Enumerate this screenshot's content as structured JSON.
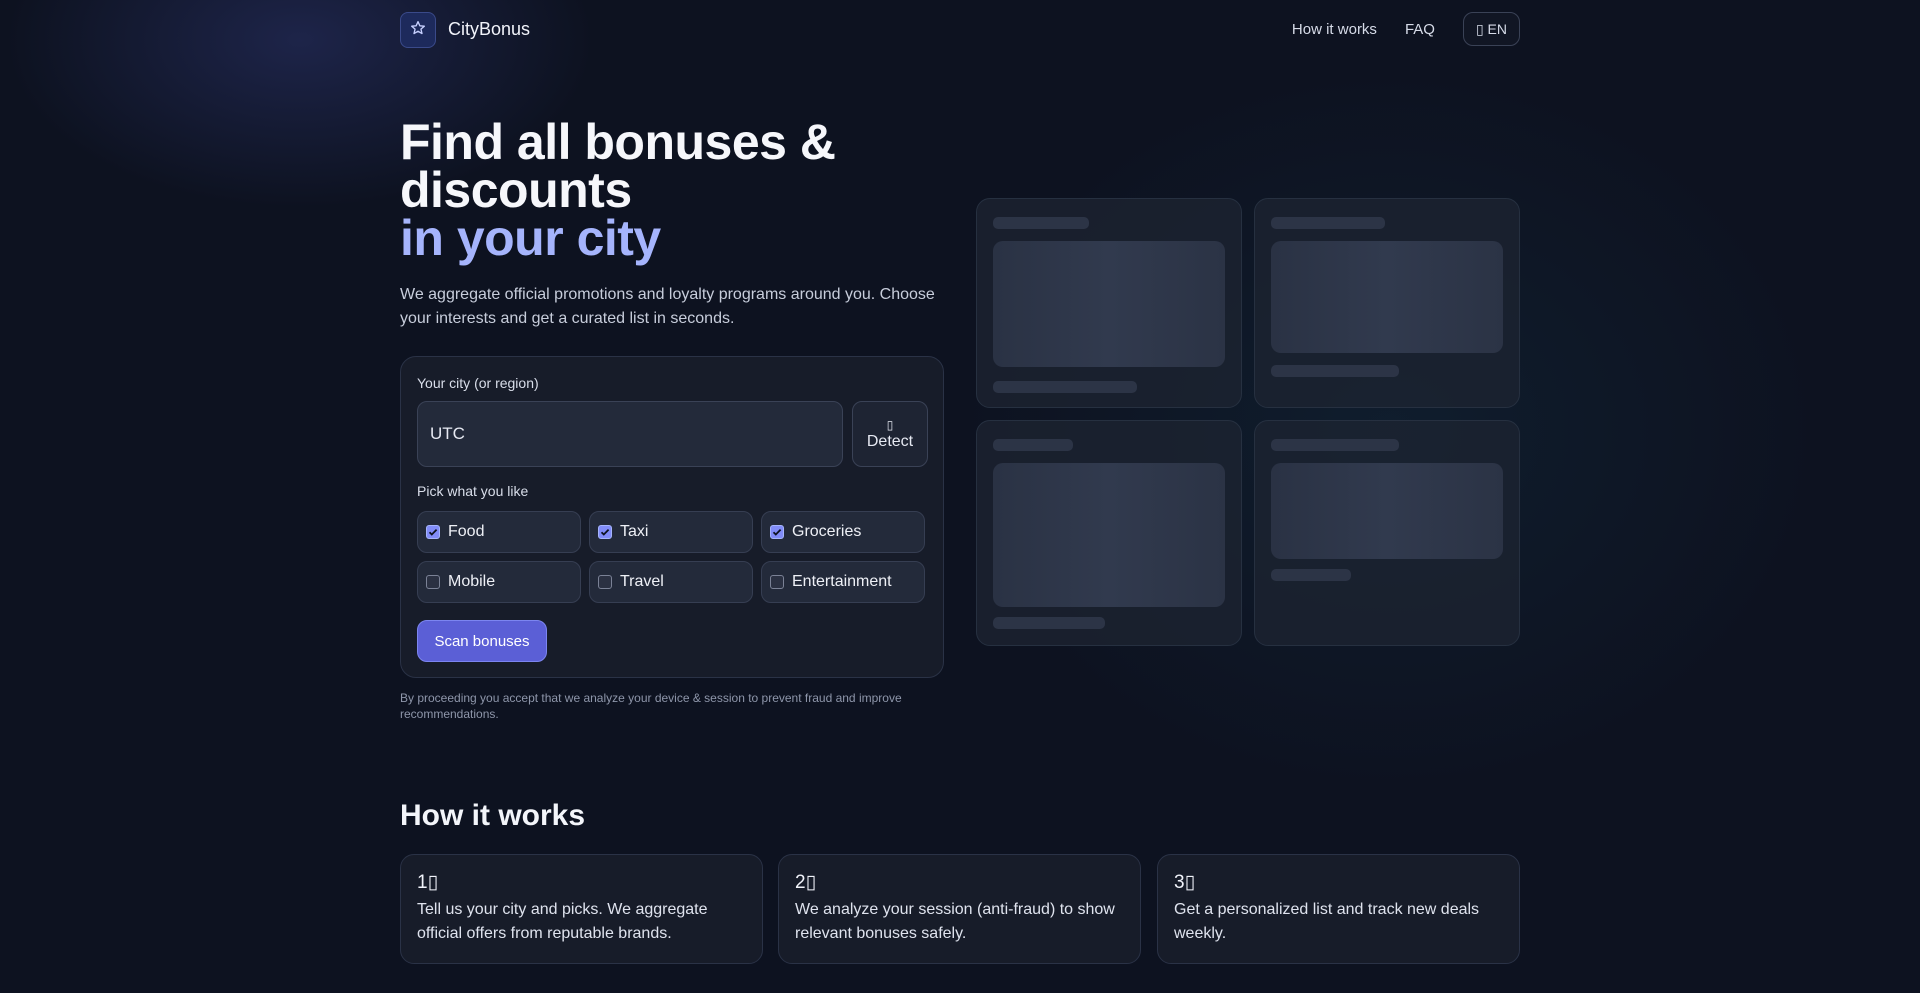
{
  "header": {
    "brand": "CityBonus",
    "nav_how": "How it works",
    "nav_faq": "FAQ",
    "lang_label": "▯ EN"
  },
  "hero": {
    "title_line1": "Find all bonuses &",
    "title_line2": "discounts",
    "title_accent": "in your city",
    "lead": "We aggregate official promotions and loyalty programs around you. Choose your interests and get a curated list in seconds."
  },
  "form": {
    "city_label": "Your city (or region)",
    "city_value": "UTC",
    "detect_glyph": "▯",
    "detect_label": "Detect",
    "pick_label": "Pick what you like",
    "categories": [
      {
        "label": "Food",
        "checked": true
      },
      {
        "label": "Taxi",
        "checked": true
      },
      {
        "label": "Groceries",
        "checked": true
      },
      {
        "label": "Mobile",
        "checked": false
      },
      {
        "label": "Travel",
        "checked": false
      },
      {
        "label": "Entertainment",
        "checked": false
      }
    ],
    "scan_button": "Scan bonuses",
    "consent": "By proceeding you accept that we analyze your device & session to prevent fraud and improve recommendations."
  },
  "how": {
    "title": "How it works",
    "steps": [
      {
        "num": "1▯",
        "text": "Tell us your city and picks. We aggregate official offers from reputable brands."
      },
      {
        "num": "2▯",
        "text": "We analyze your session (anti-fraud) to show relevant bonuses safely."
      },
      {
        "num": "3▯",
        "text": "Get a personalized list and track new deals weekly."
      }
    ]
  },
  "colors": {
    "background": "#0d1220",
    "accent": "#a5b4fc",
    "button": "#5b5fd6",
    "card": "#1a1f2c"
  }
}
